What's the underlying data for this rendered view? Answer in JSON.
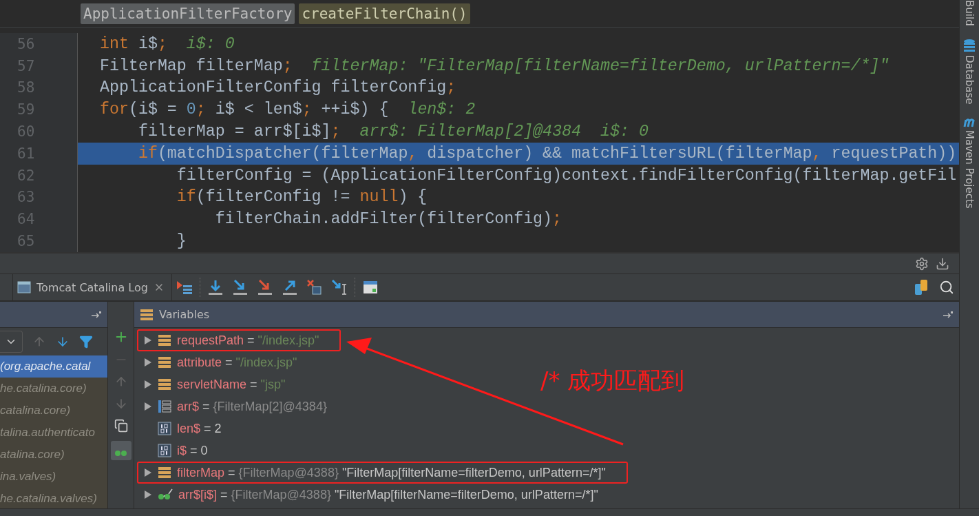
{
  "editor": {
    "breadcrumbs": [
      {
        "label": "ApplicationFilterFactory",
        "kind": "class"
      },
      {
        "label": "createFilterChain()",
        "kind": "method"
      }
    ],
    "lines": [
      {
        "number": "56",
        "selected": false,
        "tokens": [
          {
            "kind": "keyword",
            "text": "int"
          },
          {
            "kind": "plain",
            "text": " i$"
          },
          {
            "kind": "punct",
            "text": ";"
          },
          {
            "kind": "hint",
            "text": "  i$: 0"
          }
        ]
      },
      {
        "number": "57",
        "selected": false,
        "tokens": [
          {
            "kind": "plain",
            "text": "FilterMap filterMap"
          },
          {
            "kind": "punct",
            "text": ";"
          },
          {
            "kind": "hint",
            "text": "  filterMap: \"FilterMap[filterName=filterDemo, urlPattern=/*]\""
          }
        ]
      },
      {
        "number": "58",
        "selected": false,
        "tokens": [
          {
            "kind": "plain",
            "text": "ApplicationFilterConfig filterConfig"
          },
          {
            "kind": "punct",
            "text": ";"
          }
        ]
      },
      {
        "number": "59",
        "selected": false,
        "tokens": [
          {
            "kind": "keyword",
            "text": "for"
          },
          {
            "kind": "plain",
            "text": "(i$ = "
          },
          {
            "kind": "number",
            "text": "0"
          },
          {
            "kind": "punct",
            "text": ";"
          },
          {
            "kind": "plain",
            "text": " i$ < len$"
          },
          {
            "kind": "punct",
            "text": ";"
          },
          {
            "kind": "plain",
            "text": " ++i$) {"
          },
          {
            "kind": "hint",
            "text": "  len$: 2"
          }
        ]
      },
      {
        "number": "60",
        "selected": false,
        "tokens": [
          {
            "kind": "plain",
            "text": "    filterMap = arr$[i$]"
          },
          {
            "kind": "punct",
            "text": ";"
          },
          {
            "kind": "hint",
            "text": "  arr$: FilterMap[2]@4384  i$: 0"
          }
        ]
      },
      {
        "number": "61",
        "selected": true,
        "tokens": [
          {
            "kind": "keyword",
            "text": "    if"
          },
          {
            "kind": "plain",
            "text": "(matchDispatcher(filterMap"
          },
          {
            "kind": "punct",
            "text": ","
          },
          {
            "kind": "plain",
            "text": " dispatcher) && matchFiltersURL(filterMap"
          },
          {
            "kind": "punct",
            "text": ","
          },
          {
            "kind": "plain",
            "text": " requestPath))"
          }
        ]
      },
      {
        "number": "62",
        "selected": false,
        "tokens": [
          {
            "kind": "plain",
            "text": "        filterConfig = (ApplicationFilterConfig)context.findFilterConfig(filterMap.getFil"
          }
        ]
      },
      {
        "number": "63",
        "selected": false,
        "tokens": [
          {
            "kind": "keyword",
            "text": "        if"
          },
          {
            "kind": "plain",
            "text": "(filterConfig != "
          },
          {
            "kind": "keyword",
            "text": "null"
          },
          {
            "kind": "plain",
            "text": ") {"
          }
        ]
      },
      {
        "number": "64",
        "selected": false,
        "tokens": [
          {
            "kind": "plain",
            "text": "            filterChain.addFilter(filterConfig)"
          },
          {
            "kind": "punct",
            "text": ";"
          }
        ]
      },
      {
        "number": "65",
        "selected": false,
        "tokens": [
          {
            "kind": "plain",
            "text": "        }"
          }
        ]
      }
    ]
  },
  "side_tools": [
    {
      "label": "Build",
      "kind": "build"
    },
    {
      "label": "Database",
      "kind": "database"
    },
    {
      "label": "Maven Projects",
      "kind": "maven"
    }
  ],
  "debug": {
    "tab": {
      "label": "Tomcat Catalina Log"
    },
    "frames": [
      {
        "text": "(org.apache.catal",
        "selected": true
      },
      {
        "text": "he.catalina.core)",
        "selected": false
      },
      {
        "text": "catalina.core)",
        "selected": false
      },
      {
        "text": "talina.authenticato",
        "selected": false
      },
      {
        "text": "atalina.core)",
        "selected": false
      },
      {
        "text": "ina.valves)",
        "selected": false
      },
      {
        "text": "he.catalina.valves)",
        "selected": false
      }
    ],
    "variables": {
      "title": "Variables",
      "rows": [
        {
          "kind": "field",
          "expandable": true,
          "highlighted": true,
          "name": "requestPath",
          "operator": "=",
          "value": [
            {
              "kind": "string",
              "text": "\"/index.jsp\""
            }
          ]
        },
        {
          "kind": "field",
          "expandable": true,
          "highlighted": false,
          "name": "attribute",
          "operator": "=",
          "value": [
            {
              "kind": "string",
              "text": "\"/index.jsp\""
            }
          ]
        },
        {
          "kind": "field",
          "expandable": true,
          "highlighted": false,
          "name": "servletName",
          "operator": "=",
          "value": [
            {
              "kind": "string",
              "text": "\"jsp\""
            }
          ]
        },
        {
          "kind": "array",
          "expandable": true,
          "highlighted": false,
          "name": "arr$",
          "operator": "=",
          "value": [
            {
              "kind": "ref",
              "text": "{FilterMap[2]@4384}"
            }
          ]
        },
        {
          "kind": "primitive",
          "expandable": false,
          "highlighted": false,
          "name": "len$",
          "operator": "=",
          "value": [
            {
              "kind": "plain",
              "text": "2"
            }
          ]
        },
        {
          "kind": "primitive",
          "expandable": false,
          "highlighted": false,
          "name": "i$",
          "operator": "=",
          "value": [
            {
              "kind": "plain",
              "text": "0"
            }
          ]
        },
        {
          "kind": "field",
          "expandable": true,
          "highlighted": true,
          "name": "filterMap",
          "operator": "=",
          "value": [
            {
              "kind": "ref",
              "text": "{FilterMap@4388}"
            },
            {
              "kind": "plain",
              "text": "\"FilterMap[filterName=filterDemo, urlPattern=/*]\""
            }
          ]
        },
        {
          "kind": "watch",
          "expandable": true,
          "highlighted": false,
          "name": "arr$[i$]",
          "operator": "=",
          "value": [
            {
              "kind": "ref",
              "text": "{FilterMap@4388}"
            },
            {
              "kind": "plain",
              "text": "\"FilterMap[filterName=filterDemo, urlPattern=/*]\""
            }
          ]
        }
      ]
    }
  },
  "annotation": {
    "text": "/* 成功匹配到"
  }
}
